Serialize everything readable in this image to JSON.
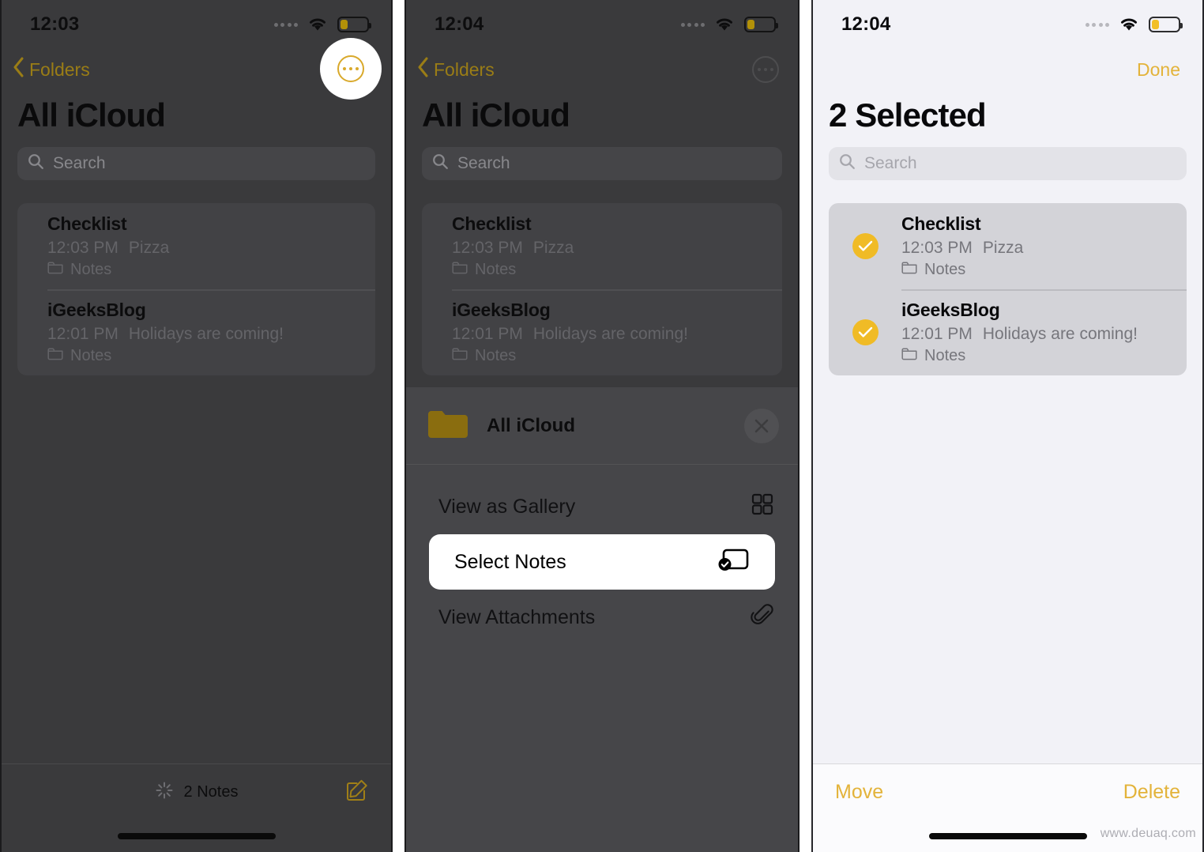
{
  "panels": [
    {
      "id": "panel-notes-list",
      "status": {
        "time": "12:03"
      },
      "nav": {
        "back_label": "Folders",
        "more_icon": "ellipsis-circle-icon"
      },
      "title": "All iCloud",
      "search": {
        "placeholder": "Search"
      },
      "notes": [
        {
          "title": "Checklist",
          "time": "12:03 PM",
          "preview": "Pizza",
          "folder": "Notes"
        },
        {
          "title": "iGeeksBlog",
          "time": "12:01 PM",
          "preview": "Holidays are coming!",
          "folder": "Notes"
        }
      ],
      "toolbar": {
        "count_label": "2 Notes",
        "compose_icon": "compose-icon",
        "sync_icon": "sync-spinner-icon"
      }
    },
    {
      "id": "panel-action-sheet",
      "status": {
        "time": "12:04"
      },
      "nav": {
        "back_label": "Folders",
        "more_icon": "ellipsis-circle-icon"
      },
      "title": "All iCloud",
      "search": {
        "placeholder": "Search"
      },
      "notes": [
        {
          "title": "Checklist",
          "time": "12:03 PM",
          "preview": "Pizza",
          "folder": "Notes"
        },
        {
          "title": "iGeeksBlog",
          "time": "12:01 PM",
          "preview": "Holidays are coming!",
          "folder": "Notes"
        }
      ],
      "sheet": {
        "header_title": "All iCloud",
        "header_icon": "folder-filled-icon",
        "close_icon": "close-icon",
        "items": [
          {
            "label": "View as Gallery",
            "icon": "grid-icon",
            "highlighted": false
          },
          {
            "label": "Select Notes",
            "icon": "select-notes-icon",
            "highlighted": true
          },
          {
            "label": "View Attachments",
            "icon": "paperclip-icon",
            "highlighted": false
          }
        ]
      }
    },
    {
      "id": "panel-selection-mode",
      "status": {
        "time": "12:04"
      },
      "nav": {
        "done_label": "Done"
      },
      "title": "2 Selected",
      "search": {
        "placeholder": "Search"
      },
      "notes": [
        {
          "title": "Checklist",
          "time": "12:03 PM",
          "preview": "Pizza",
          "folder": "Notes",
          "selected": true
        },
        {
          "title": "iGeeksBlog",
          "time": "12:01 PM",
          "preview": "Holidays are coming!",
          "folder": "Notes",
          "selected": true
        }
      ],
      "toolbar": {
        "move_label": "Move",
        "delete_label": "Delete"
      }
    }
  ],
  "watermark": "www.deuaq.com",
  "colors": {
    "accent_yellow": "#e3b33a",
    "check_yellow": "#f0bb26",
    "dark_bg": "#3a3a3c",
    "light_bg": "#f2f2f7"
  }
}
